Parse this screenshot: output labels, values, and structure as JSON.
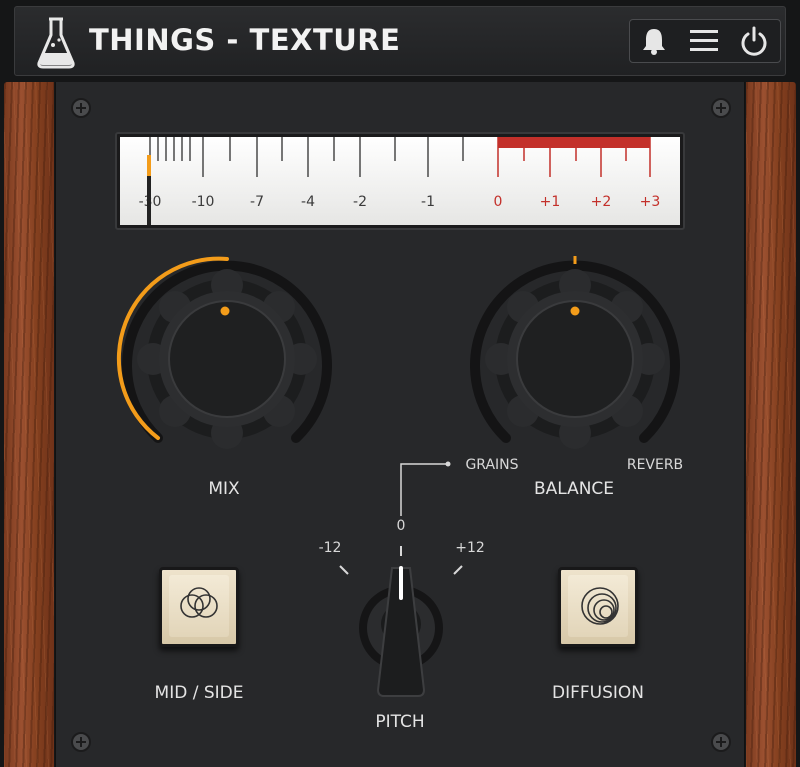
{
  "app": {
    "title": "THINGS - TEXTURE",
    "accent_color": "#f39c1a",
    "meter_red": "#c3302a"
  },
  "header_icons": [
    {
      "name": "bell-icon"
    },
    {
      "name": "menu-icon"
    },
    {
      "name": "power-icon"
    }
  ],
  "meter": {
    "labels": [
      "-30",
      "-10",
      "-7",
      "-4",
      "-2",
      "-1",
      "0",
      "+1",
      "+2",
      "+3"
    ],
    "red_zone_start_label": "0",
    "current_level_label": "-30"
  },
  "knobs": {
    "mix": {
      "label": "MIX",
      "value_fraction": 0.5
    },
    "balance": {
      "label": "BALANCE",
      "left_label": "GRAINS",
      "right_label": "REVERB",
      "value_fraction": 0.5
    }
  },
  "pitch": {
    "label": "PITCH",
    "left_label": "-12",
    "center_label": "0",
    "right_label": "+12",
    "value": "0"
  },
  "buttons": {
    "mid_side": {
      "label": "MID / SIDE"
    },
    "diffusion": {
      "label": "DIFFUSION"
    }
  }
}
